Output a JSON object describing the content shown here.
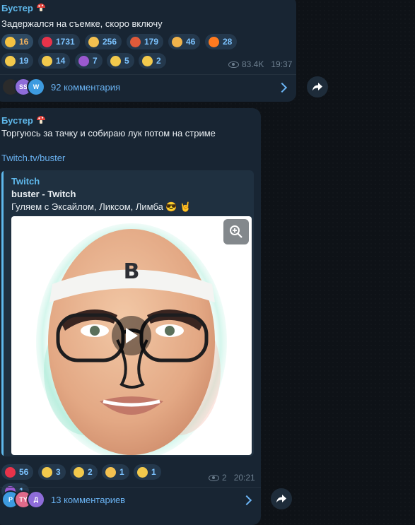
{
  "messages": [
    {
      "sender": "Бустер",
      "text": "Задержался на съемке, скоро включу",
      "reactions": [
        {
          "emoji": "star-emoji",
          "count": "16",
          "color": "#f6c342",
          "active": true
        },
        {
          "emoji": "red-heart-emoji",
          "count": "1731",
          "color": "#e8334a"
        },
        {
          "emoji": "thumbs-up-emoji",
          "count": "256",
          "color": "#f4c150"
        },
        {
          "emoji": "angry-face-emoji",
          "count": "179",
          "color": "#e05a3a"
        },
        {
          "emoji": "exploding-head-emoji",
          "count": "46",
          "color": "#f0b34b"
        },
        {
          "emoji": "fire-emoji",
          "count": "28",
          "color": "#ff7a1f"
        },
        {
          "emoji": "crying-face-emoji",
          "count": "19",
          "color": "#f2c94c"
        },
        {
          "emoji": "rofl-emoji",
          "count": "14",
          "color": "#f2c94c"
        },
        {
          "emoji": "smiling-devil-emoji",
          "count": "7",
          "color": "#9b59d0"
        },
        {
          "emoji": "thinking-face-emoji",
          "count": "5",
          "color": "#f2c94c"
        },
        {
          "emoji": "screaming-face-emoji",
          "count": "2",
          "color": "#f2c94c"
        }
      ],
      "views": "83.4K",
      "time": "19:37",
      "comments": {
        "label": "92 комментария",
        "avatars": [
          {
            "text": "",
            "color": "#2b2b2b"
          },
          {
            "text": "SS",
            "color": "#8e6cd9"
          },
          {
            "text": "W",
            "color": "#3d9be0"
          }
        ]
      }
    },
    {
      "sender": "Бустер",
      "text": "Торгуюсь за тачку и собираю лук потом на стриме",
      "link": "Twitch.tv/buster",
      "preview": {
        "site": "Twitch",
        "title": "buster - Twitch",
        "description": "Гуляем с Эксайлом, Ликсом, Лимба 😎 🤘",
        "headband_letter": "B"
      },
      "reactions": [
        {
          "emoji": "red-heart-emoji",
          "count": "56",
          "color": "#e8334a"
        },
        {
          "emoji": "rofl-emoji",
          "count": "3",
          "color": "#f2c94c"
        },
        {
          "emoji": "screaming-face-emoji",
          "count": "2",
          "color": "#f2c94c"
        },
        {
          "emoji": "thumbs-up-emoji",
          "count": "1",
          "color": "#f4c150"
        },
        {
          "emoji": "thinking-face-emoji",
          "count": "1",
          "color": "#f2c94c"
        },
        {
          "emoji": "smiling-devil-emoji",
          "count": "1",
          "color": "#9b59d0"
        }
      ],
      "views": "2",
      "time": "20:21",
      "comments": {
        "label": "13 комментариев",
        "avatars": [
          {
            "text": "P",
            "color": "#3d9be0"
          },
          {
            "text": "TY",
            "color": "#e06a8a"
          },
          {
            "text": "Д",
            "color": "#8e6cd9"
          }
        ]
      }
    }
  ]
}
